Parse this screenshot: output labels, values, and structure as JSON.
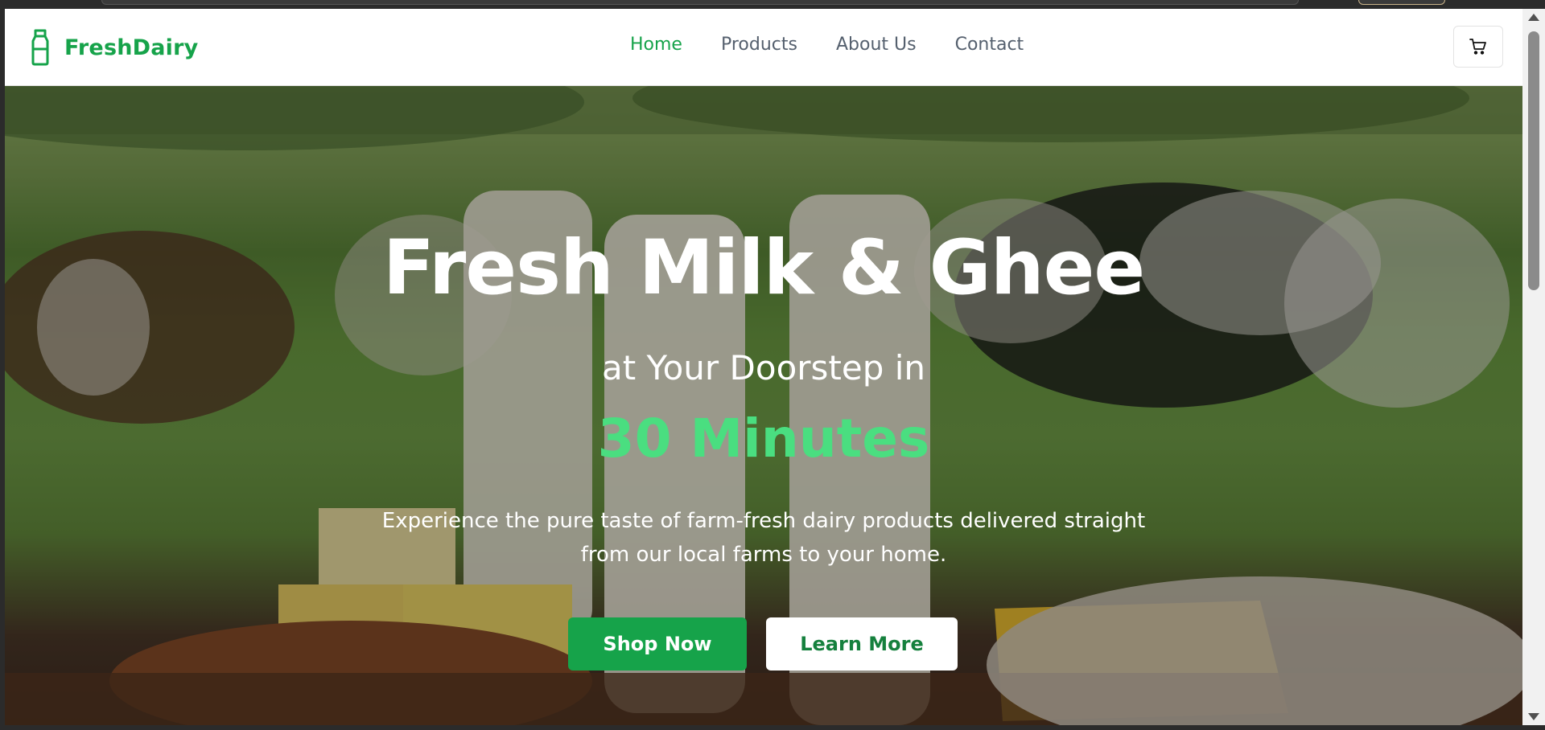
{
  "brand": {
    "name": "FreshDairy",
    "icon": "milk-bottle-icon"
  },
  "nav": {
    "items": [
      {
        "label": "Home",
        "active": true
      },
      {
        "label": "Products",
        "active": false
      },
      {
        "label": "About Us",
        "active": false
      },
      {
        "label": "Contact",
        "active": false
      }
    ],
    "cart_icon": "shopping-cart-icon"
  },
  "hero": {
    "title": "Fresh Milk & Ghee",
    "subtitle": "at Your Doorstep in",
    "highlight": "30 Minutes",
    "description": "Experience the pure taste of farm-fresh dairy products delivered straight from our local farms to your home.",
    "primary_button": "Shop Now",
    "secondary_button": "Learn More"
  },
  "colors": {
    "brand_green": "#16a34a",
    "highlight_green": "#4ade80",
    "nav_text": "#55606e"
  }
}
